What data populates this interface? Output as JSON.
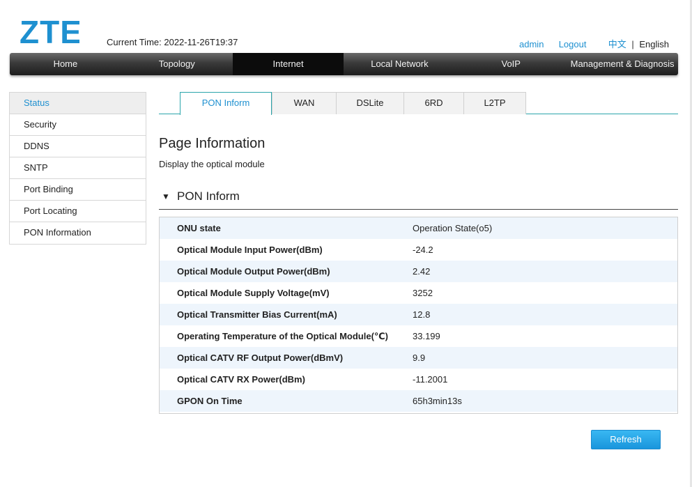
{
  "brand": {
    "logo_text": "ZTE",
    "color": "#1e90d0"
  },
  "header": {
    "current_time": "Current Time: 2022-11-26T19:37",
    "user": "admin",
    "logout": "Logout",
    "lang_zh": "中文",
    "lang_sep": "|",
    "lang_en": "English"
  },
  "nav": {
    "items": [
      "Home",
      "Topology",
      "Internet",
      "Local Network",
      "VoIP",
      "Management & Diagnosis"
    ],
    "active": "Internet"
  },
  "sidebar": {
    "items": [
      "Status",
      "Security",
      "DDNS",
      "SNTP",
      "Port Binding",
      "Port Locating",
      "PON Information"
    ],
    "active": "Status"
  },
  "tabs": {
    "items": [
      "PON Inform",
      "WAN",
      "DSLite",
      "6RD",
      "L2TP"
    ],
    "active": "PON Inform"
  },
  "page": {
    "title": "Page Information",
    "description": "Display the optical module"
  },
  "section": {
    "title": "PON Inform",
    "icon": "triangle-down-icon"
  },
  "pon_info": [
    {
      "label": "ONU state",
      "value": "Operation State(o5)"
    },
    {
      "label": "Optical Module Input Power(dBm)",
      "value": "-24.2"
    },
    {
      "label": "Optical Module Output Power(dBm)",
      "value": "2.42"
    },
    {
      "label": "Optical Module Supply Voltage(mV)",
      "value": "3252"
    },
    {
      "label": "Optical Transmitter Bias Current(mA)",
      "value": "12.8"
    },
    {
      "label": "Operating Temperature of the Optical Module(℃)",
      "value": "33.199"
    },
    {
      "label": "Optical CATV RF Output Power(dBmV)",
      "value": "9.9"
    },
    {
      "label": "Optical CATV RX Power(dBm)",
      "value": "-11.2001"
    },
    {
      "label": "GPON On Time",
      "value": "65h3min13s"
    }
  ],
  "buttons": {
    "refresh": "Refresh"
  },
  "colors": {
    "accent": "#1e90d0",
    "tab_border": "#2aa5ab",
    "row_stripe": "#eef5fc",
    "nav_active": "#0c0c0c"
  }
}
